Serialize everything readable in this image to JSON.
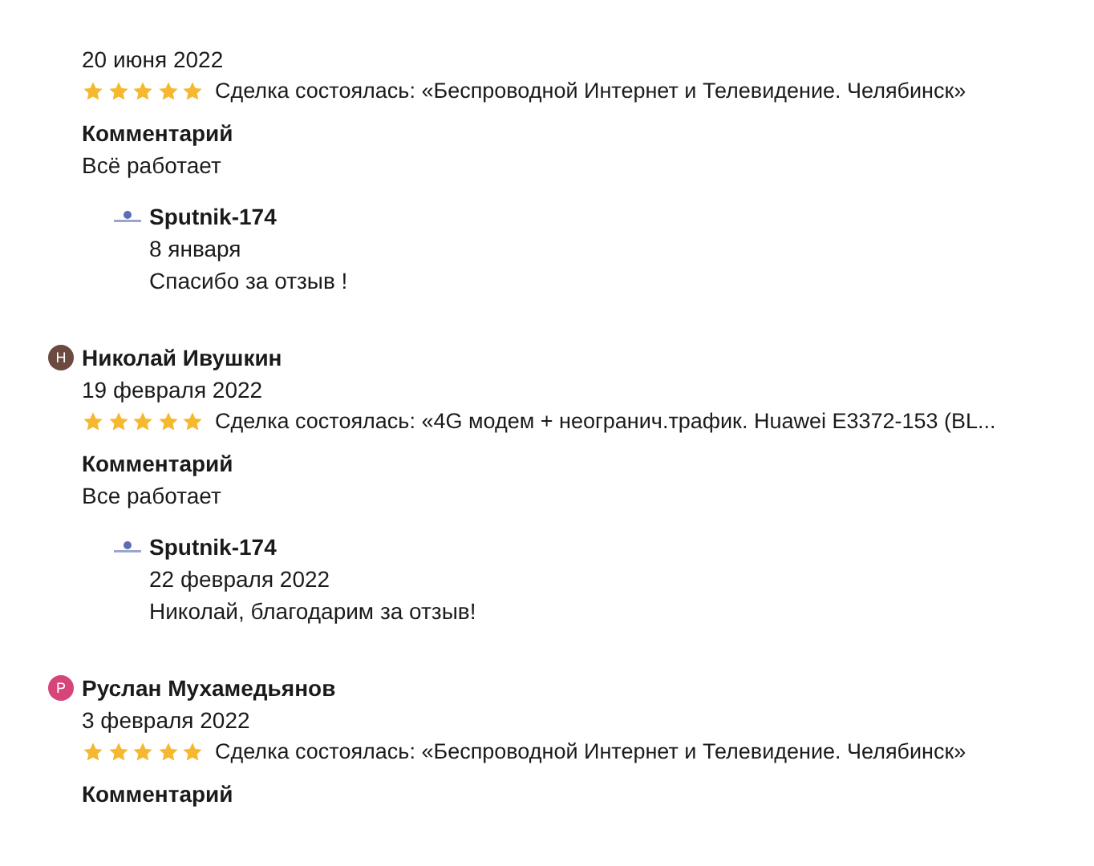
{
  "reviews": [
    {
      "date": "20 июня 2022",
      "stars": 5,
      "deal": "Сделка состоялась: «Беспроводной Интернет и Телевидение. Челябинск»",
      "comment_label": "Комментарий",
      "comment": "Всё работает",
      "reply": {
        "author": "Sputnik-174",
        "date": "8 января",
        "text": "Спасибо за отзыв !"
      }
    },
    {
      "author": "Николай Ивушкин",
      "avatar": {
        "letter": "Н",
        "color": "#6b4a3f"
      },
      "date": "19 февраля 2022",
      "stars": 5,
      "deal": "Сделка состоялась: «4G модем + неогранич.трафик. Huawei E3372-153 (BL...",
      "comment_label": "Комментарий",
      "comment": "Все работает",
      "reply": {
        "author": "Sputnik-174",
        "date": "22 февраля 2022",
        "text": "Николай, благодарим за отзыв!"
      }
    },
    {
      "author": "Руслан Мухамедьянов",
      "avatar": {
        "letter": "Р",
        "color": "#d6457a"
      },
      "date": "3 февраля 2022",
      "stars": 5,
      "deal": "Сделка состоялась: «Беспроводной Интернет и Телевидение. Челябинск»",
      "comment_label": "Комментарий"
    }
  ]
}
